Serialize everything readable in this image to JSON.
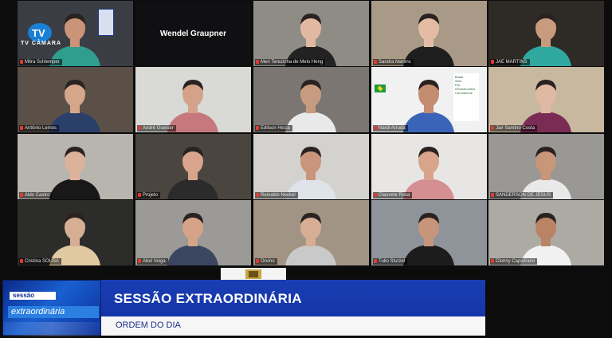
{
  "participants": [
    {
      "name": "Mitra Schlemper",
      "bg": "#3a3d44",
      "shirt": "#2f9e8e",
      "skin": "#c99478",
      "row": 0,
      "col": 0
    },
    {
      "name": "Wendel Graupner",
      "video": false,
      "row": 0,
      "col": 1
    },
    {
      "name": "Meri Terezinha de Melo Heng",
      "bg": "#8f8c86",
      "shirt": "#222222",
      "skin": "#e1b9a2",
      "row": 0,
      "col": 2
    },
    {
      "name": "Sandra Martins",
      "bg": "#a89a86",
      "shirt": "#1e1e1e",
      "skin": "#e4bca4",
      "row": 0,
      "col": 3
    },
    {
      "name": "JAE MARTINS",
      "bg": "#2e2a26",
      "shirt": "#2fa8a0",
      "skin": "#c99b7e",
      "row": 0,
      "col": 4
    },
    {
      "name": "Antônio Lemos",
      "bg": "#5a5048",
      "shirt": "#2a3f6a",
      "skin": "#d6a68a",
      "row": 1,
      "col": 0
    },
    {
      "name": "André Gueiser",
      "bg": "#d9d9d6",
      "shirt": "#c7787c",
      "skin": "#d4a288",
      "row": 1,
      "col": 1
    },
    {
      "name": "Edilson Heiza",
      "bg": "#7b7672",
      "shirt": "#e9e9e9",
      "skin": "#c79b80",
      "row": 1,
      "col": 2
    },
    {
      "name": "Nardi Arruda",
      "bg": "#f1f1f1",
      "shirt": "#3a64b8",
      "skin": "#c48c70",
      "row": 1,
      "col": 3
    },
    {
      "name": "Jair Santino Costa",
      "bg": "#c7b89f",
      "shirt": "#7b2c55",
      "skin": "#e0b9a4",
      "row": 1,
      "col": 4
    },
    {
      "name": "Aldo Castro",
      "bg": "#b8b4ae",
      "shirt": "#181818",
      "skin": "#ddb29a",
      "row": 2,
      "col": 0
    },
    {
      "name": "Projeto",
      "bg": "#4a453f",
      "shirt": "#2b2b2b",
      "skin": "#d8a58c",
      "row": 2,
      "col": 1
    },
    {
      "name": "Reinaldo Neckel",
      "bg": "#d4d2ce",
      "shirt": "#dfe3ea",
      "skin": "#c9957b",
      "row": 2,
      "col": 2
    },
    {
      "name": "Clauvete Rosa",
      "bg": "#e8e6e4",
      "shirt": "#d38f92",
      "skin": "#d8a48c",
      "row": 2,
      "col": 3
    },
    {
      "name": "SANDERSON DE JESUS",
      "bg": "#9a9894",
      "shirt": "#e9e9e9",
      "skin": "#c89679",
      "row": 2,
      "col": 4
    },
    {
      "name": "Cristina SOUSA",
      "bg": "#2c2c2a",
      "shirt": "#e0c8a0",
      "skin": "#d6ae94",
      "row": 3,
      "col": 0
    },
    {
      "name": "Abel Veiga",
      "bg": "#9b9a96",
      "shirt": "#3a4560",
      "skin": "#d5a387",
      "row": 3,
      "col": 1
    },
    {
      "name": "Orvino",
      "bg": "#a29485",
      "shirt": "#c9c9c9",
      "skin": "#d6ae94",
      "row": 3,
      "col": 2
    },
    {
      "name": "Tulio Sturzel",
      "bg": "#8e949a",
      "shirt": "#1c1c1c",
      "skin": "#c7957a",
      "row": 3,
      "col": 3
    },
    {
      "name": "Clonny Capistrano",
      "bg": "#adaaa4",
      "shirt": "#f1f1f1",
      "skin": "#b98466",
      "row": 3,
      "col": 4
    }
  ],
  "tv_logo": {
    "label": "TV CÂMARA"
  },
  "nardi_sign": {
    "lines": [
      "Brasil",
      "Sem",
      "Pai",
      "#TodosContra",
      "Coronavírus"
    ]
  },
  "banner": {
    "tag_top": "sessão",
    "tag_main": "extraordinária",
    "title": "SESSÃO EXTRAORDINÁRIA",
    "subtitle": "ORDEM DO DIA"
  },
  "colors": {
    "banner_blue": "#1b3db4",
    "mic_muted": "#e33b2e",
    "background": "#0c0c0d"
  }
}
